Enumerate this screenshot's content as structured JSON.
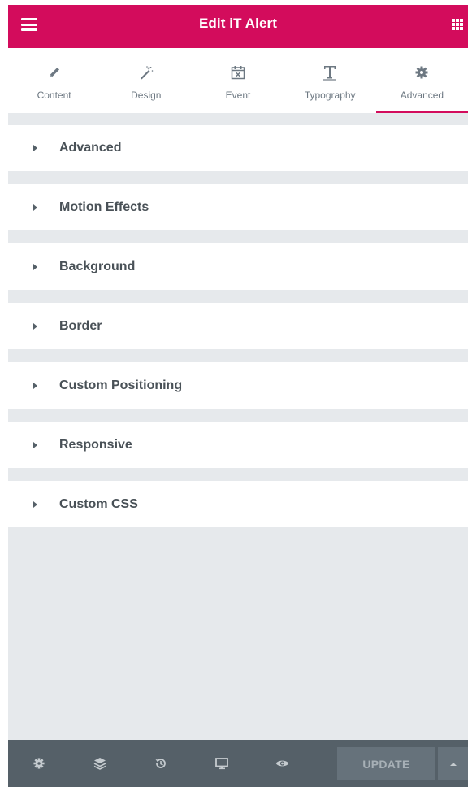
{
  "header": {
    "title": "Edit iT Alert"
  },
  "tabs": [
    {
      "label": "Content",
      "icon": "pencil-icon"
    },
    {
      "label": "Design",
      "icon": "magic-wand-icon"
    },
    {
      "label": "Event",
      "icon": "calendar-x-icon"
    },
    {
      "label": "Typography",
      "icon": "text-t-icon"
    },
    {
      "label": "Advanced",
      "icon": "gear-icon",
      "active": true
    }
  ],
  "sections": [
    {
      "title": "Advanced"
    },
    {
      "title": "Motion Effects"
    },
    {
      "title": "Background"
    },
    {
      "title": "Border"
    },
    {
      "title": "Custom Positioning"
    },
    {
      "title": "Responsive"
    },
    {
      "title": "Custom CSS"
    }
  ],
  "footer": {
    "icons": [
      "settings-icon",
      "layers-icon",
      "history-icon",
      "responsive-monitor-icon",
      "preview-eye-icon"
    ],
    "update_label": "UPDATE"
  },
  "colors": {
    "brand": "#d30c5c",
    "panel_bg": "#e6e9ec",
    "footer_bg": "#556068",
    "text_dark": "#495157",
    "text_muted": "#6d7882"
  }
}
